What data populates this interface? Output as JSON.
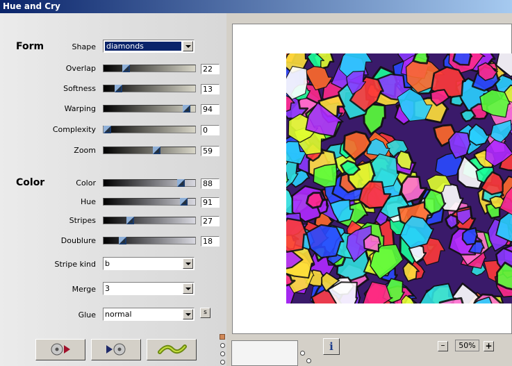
{
  "window": {
    "title": "Hue and Cry"
  },
  "form": {
    "heading": "Form",
    "shape": {
      "label": "Shape",
      "value": "diamonds"
    },
    "sliders": [
      {
        "label": "Overlap",
        "value": "22",
        "level": 0.22
      },
      {
        "label": "Softness",
        "value": "13",
        "level": 0.13
      },
      {
        "label": "Warping",
        "value": "94",
        "level": 0.94
      },
      {
        "label": "Complexity",
        "value": "0",
        "level": 0.0
      },
      {
        "label": "Zoom",
        "value": "59",
        "level": 0.59
      }
    ]
  },
  "color": {
    "heading": "Color",
    "sliders": [
      {
        "label": "Color",
        "value": "88",
        "level": 0.88
      },
      {
        "label": "Hue",
        "value": "91",
        "level": 0.91
      },
      {
        "label": "Stripes",
        "value": "27",
        "level": 0.27
      },
      {
        "label": "Doublure",
        "value": "18",
        "level": 0.18
      }
    ],
    "stripe_kind": {
      "label": "Stripe kind",
      "value": "b"
    },
    "merge": {
      "label": "Merge",
      "value": "3"
    },
    "glue": {
      "label": "Glue",
      "value": "normal",
      "s_button": "s"
    }
  },
  "toolbar": {
    "zoom_value": "50%",
    "zoom_minus": "–",
    "zoom_plus": "+",
    "info": "i"
  },
  "icons": {
    "load": "disc-play-icon",
    "save": "play-disc-icon",
    "randomize": "wave-icon"
  }
}
